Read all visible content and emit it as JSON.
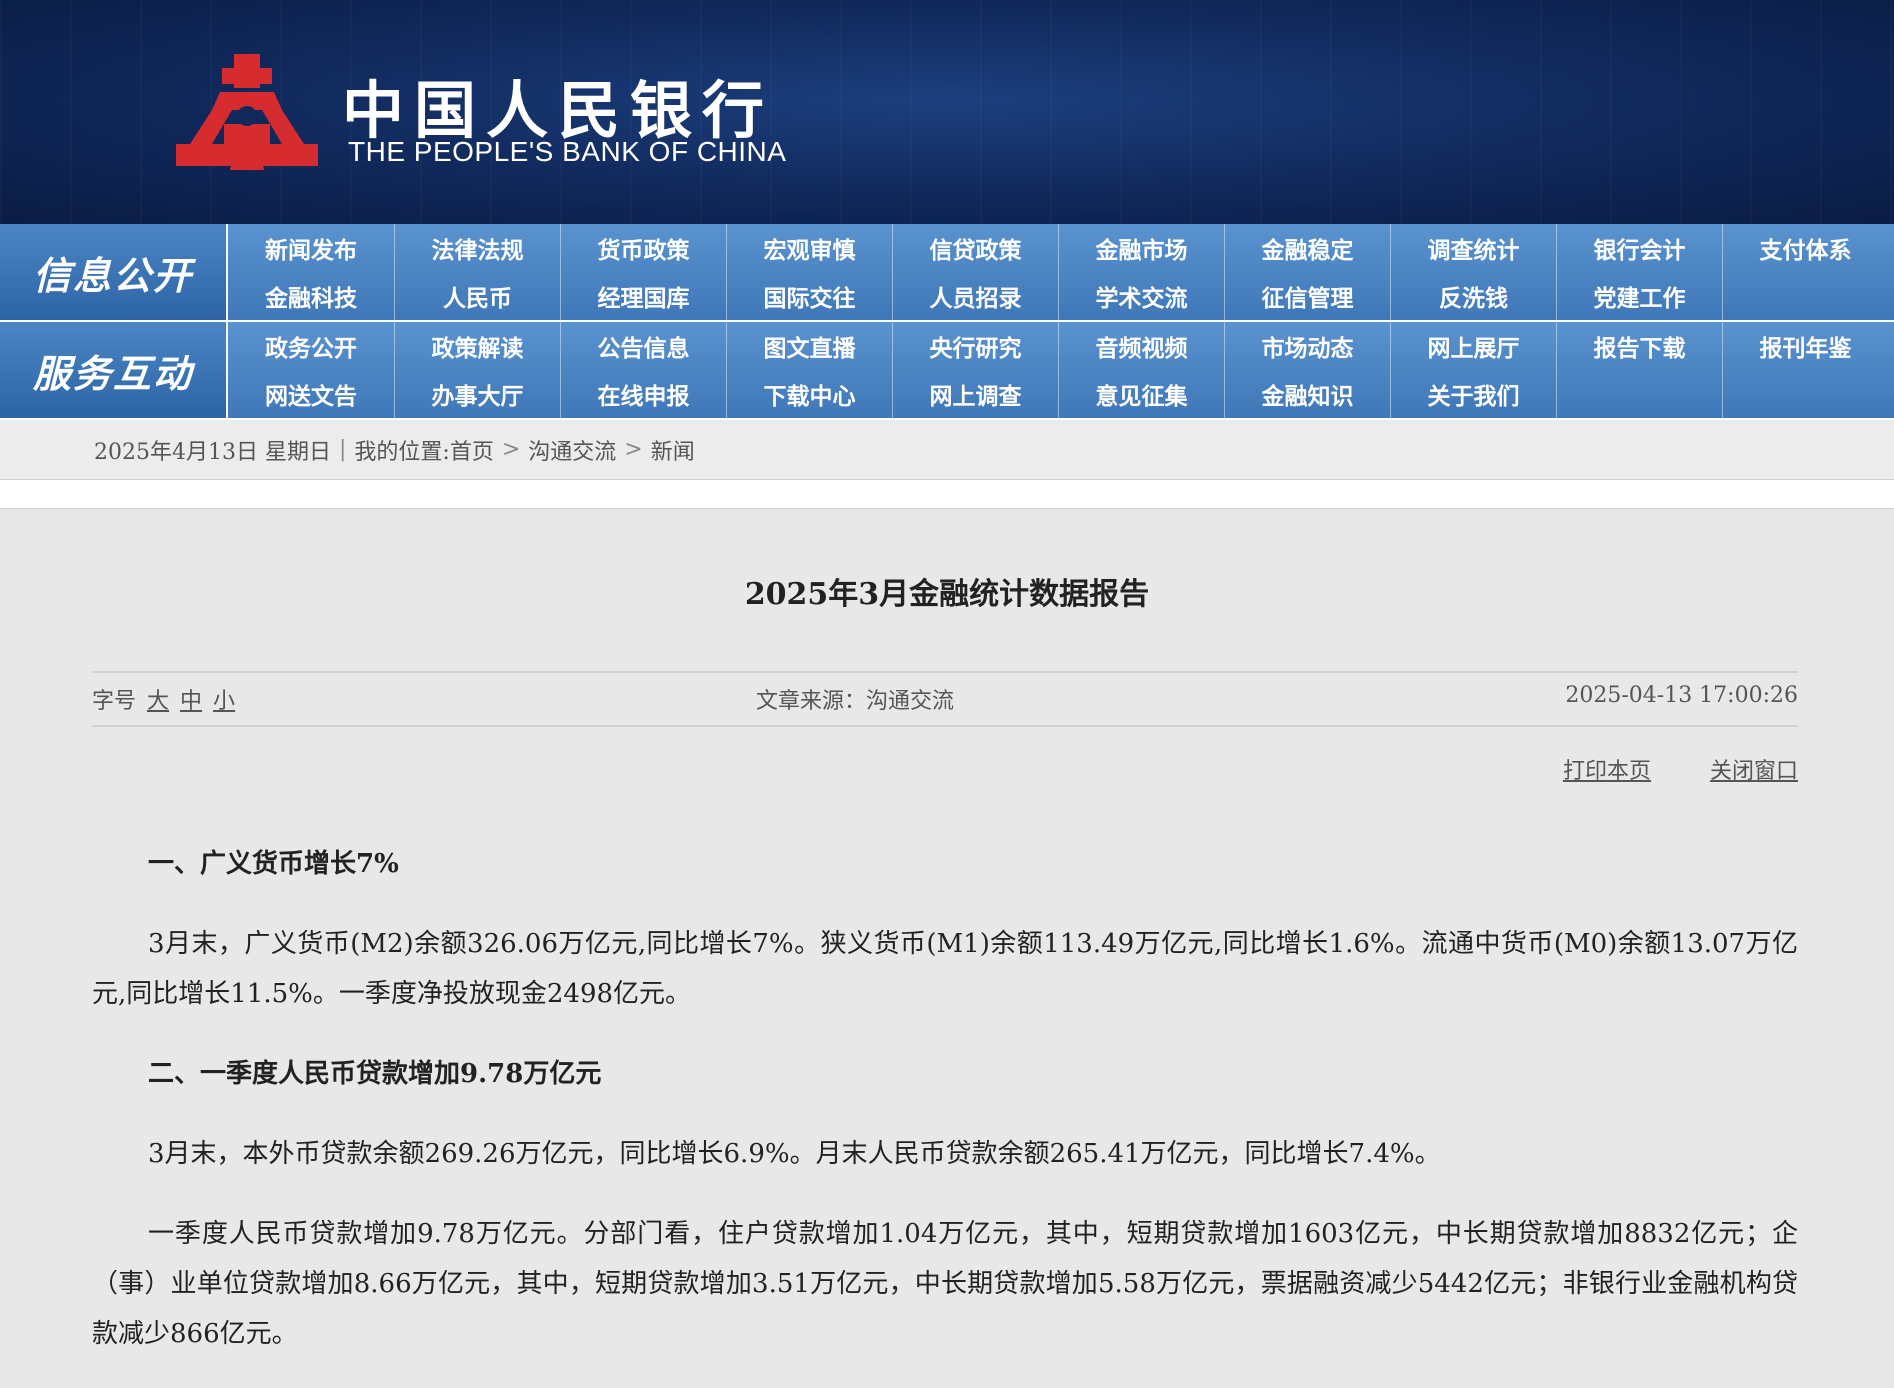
{
  "header": {
    "title_cn": "中国人民银行",
    "title_en": "THE PEOPLE'S BANK OF CHINA",
    "brand_color": "#c8232c"
  },
  "nav": {
    "group1": {
      "label": "信息公开",
      "row1": [
        "新闻发布",
        "法律法规",
        "货币政策",
        "宏观审慎",
        "信贷政策",
        "金融市场",
        "金融稳定",
        "调查统计",
        "银行会计",
        "支付体系"
      ],
      "row2": [
        "金融科技",
        "人民币",
        "经理国库",
        "国际交往",
        "人员招录",
        "学术交流",
        "征信管理",
        "反洗钱",
        "党建工作"
      ]
    },
    "group2": {
      "label": "服务互动",
      "row1": [
        "政务公开",
        "政策解读",
        "公告信息",
        "图文直播",
        "央行研究",
        "音频视频",
        "市场动态",
        "网上展厅",
        "报告下载",
        "报刊年鉴"
      ],
      "row2": [
        "网送文告",
        "办事大厅",
        "在线申报",
        "下载中心",
        "网上调查",
        "意见征集",
        "金融知识",
        "关于我们"
      ]
    }
  },
  "breadcrumb": {
    "date": "2025年4月13日 星期日",
    "divider": "|",
    "prefix": "我的位置:",
    "home": "首页",
    "arrow": ">",
    "section": "沟通交流",
    "current": "新闻"
  },
  "article": {
    "title": "2025年3月金融统计数据报告",
    "font_size_label": "字号",
    "font_large": "大",
    "font_medium": "中",
    "font_small": "小",
    "source": "文章来源：沟通交流",
    "datetime": "2025-04-13 17:00:26",
    "print_label": "打印本页",
    "close_label": "关闭窗口",
    "h1": "一、广义货币增长7%",
    "p1": "3月末，广义货币(M2)余额326.06万亿元,同比增长7%。狭义货币(M1)余额113.49万亿元,同比增长1.6%。流通中货币(M0)余额13.07万亿元,同比增长11.5%。一季度净投放现金2498亿元。",
    "h2": "二、一季度人民币贷款增加9.78万亿元",
    "p2": "3月末，本外币贷款余额269.26万亿元，同比增长6.9%。月末人民币贷款余额265.41万亿元，同比增长7.4%。",
    "p3": "一季度人民币贷款增加9.78万亿元。分部门看，住户贷款增加1.04万亿元，其中，短期贷款增加1603亿元，中长期贷款增加8832亿元；企（事）业单位贷款增加8.66万亿元，其中，短期贷款增加3.51万亿元，中长期贷款增加5.58万亿元，票据融资减少5442亿元；非银行业金融机构贷款减少866亿元。"
  }
}
